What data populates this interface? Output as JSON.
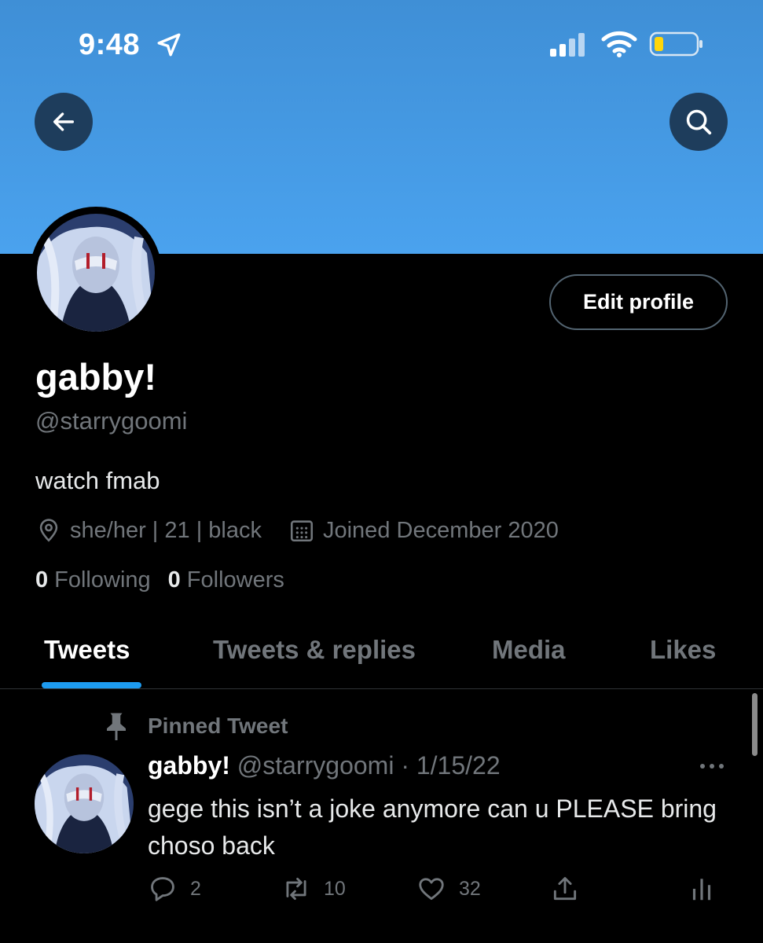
{
  "status_bar": {
    "time": "9:48",
    "icons": [
      "location-arrow-icon",
      "cellular-signal-icon",
      "wifi-icon",
      "battery-low-icon"
    ]
  },
  "colors": {
    "banner_top": "#3f8fd6",
    "banner_bottom": "#4aa2ee",
    "accent": "#1d9bf0",
    "battery": "#ffd60a"
  },
  "profile": {
    "display_name": "gabby!",
    "handle": "@starrygoomi",
    "bio": "watch fmab",
    "location": "she/her | 21 | black",
    "joined": "Joined December 2020",
    "following_count": "0",
    "following_label": "Following",
    "followers_count": "0",
    "followers_label": "Followers",
    "edit_button": "Edit profile"
  },
  "tabs": [
    {
      "label": "Tweets",
      "active": true
    },
    {
      "label": "Tweets & replies",
      "active": false
    },
    {
      "label": "Media",
      "active": false
    },
    {
      "label": "Likes",
      "active": false
    }
  ],
  "pinned_tweet": {
    "pinned_label": "Pinned Tweet",
    "author_name": "gabby!",
    "author_handle": "@starrygoomi",
    "separator": " · ",
    "date": "1/15/22",
    "text": "gege this isn’t a joke anymore can u PLEASE bring choso back",
    "replies": "2",
    "retweets": "10",
    "likes": "32"
  }
}
